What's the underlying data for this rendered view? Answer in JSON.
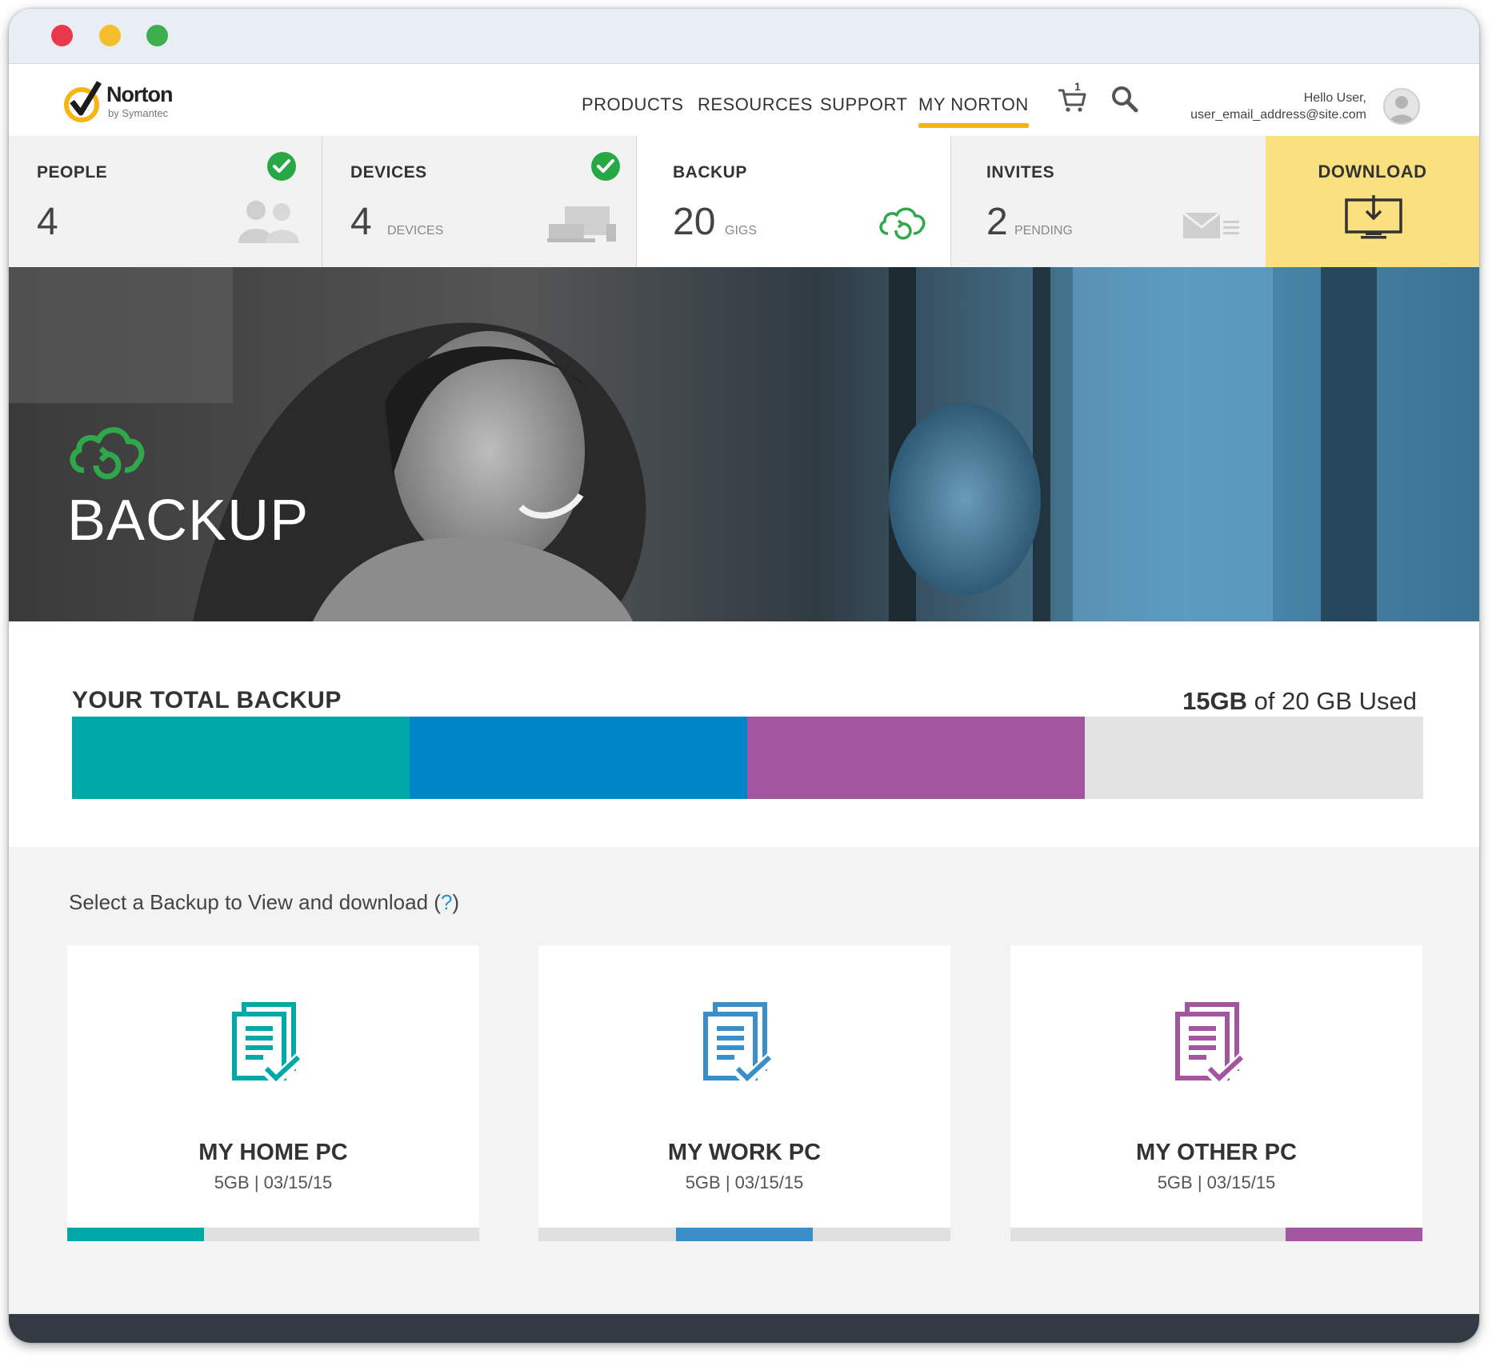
{
  "window": {
    "controls": [
      "close",
      "minimize",
      "maximize"
    ]
  },
  "header": {
    "logo": {
      "name": "Norton",
      "sub": "by Symantec"
    },
    "nav": [
      {
        "label": "PRODUCTS",
        "active": false
      },
      {
        "label": "RESOURCES",
        "active": false
      },
      {
        "label": "SUPPORT",
        "active": false
      },
      {
        "label": "MY NORTON",
        "active": true
      }
    ],
    "cart_count": "1",
    "greeting": "Hello User,",
    "email": "user_email_address@site.com",
    "icons": [
      "cart-icon",
      "search-icon",
      "avatar-icon"
    ]
  },
  "stats": {
    "people": {
      "label": "PEOPLE",
      "value": "4",
      "icon": "people-icon",
      "status_icon": "check-icon"
    },
    "devices": {
      "label": "DEVICES",
      "value": "4",
      "unit": "DEVICES",
      "icon": "devices-icon",
      "status_icon": "check-icon"
    },
    "backup": {
      "label": "BACKUP",
      "value": "20",
      "unit": "GIGS",
      "icon": "cloud-sync-icon"
    },
    "invites": {
      "label": "INVITES",
      "value": "2",
      "unit": "PENDING",
      "icon": "mail-icon"
    },
    "download": {
      "label": "DOWNLOAD",
      "icon": "monitor-download-icon"
    }
  },
  "hero": {
    "title": "BACKUP",
    "icon": "cloud-sync-icon"
  },
  "total": {
    "title": "YOUR TOTAL BACKUP",
    "used_amount": "15GB",
    "used_rest": " of 20 GB Used",
    "capacity_gb": 20,
    "segments": [
      {
        "name": "MY HOME PC",
        "gb": 5,
        "color": "#00a8a8"
      },
      {
        "name": "MY WORK PC",
        "gb": 5,
        "color": "#0086c8"
      },
      {
        "name": "MY OTHER PC",
        "gb": 5,
        "color": "#a355a0"
      }
    ],
    "empty_color": "#e3e3e3"
  },
  "backups": {
    "prompt": "Select a Backup to View and download",
    "help": "?",
    "items": [
      {
        "title": "MY HOME PC",
        "meta": "5GB | 03/15/15",
        "color": "#00a8a8",
        "icon": "document-check-icon",
        "share": 0.333,
        "position": "left"
      },
      {
        "title": "MY WORK PC",
        "meta": "5GB | 03/15/15",
        "color": "#3a8fcb",
        "icon": "document-check-icon",
        "share": 0.333,
        "position": "middle"
      },
      {
        "title": "MY OTHER PC",
        "meta": "5GB | 03/15/15",
        "color": "#a355a0",
        "icon": "document-check-icon",
        "share": 0.333,
        "position": "right"
      }
    ]
  },
  "colors": {
    "accent": "#f5b512",
    "download_bg": "#fbe07f",
    "check": "#27a844",
    "footer": "#323a44"
  }
}
